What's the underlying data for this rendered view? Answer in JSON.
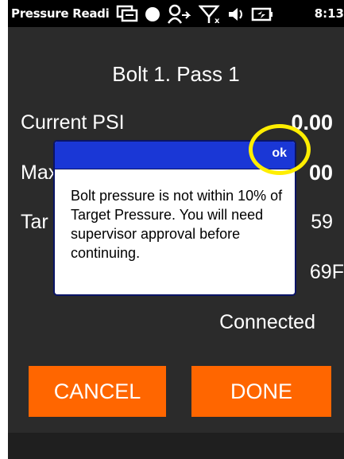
{
  "status_bar": {
    "app_title": "Pressure Readi",
    "icons": [
      "sync-icon",
      "record-icon",
      "person-sync-icon",
      "no-signal-icon",
      "volume-icon",
      "battery-icon"
    ],
    "time": "8:13"
  },
  "screen": {
    "title": "Bolt 1. Pass 1",
    "rows": [
      {
        "label": "Current PSI",
        "value": "0.00"
      },
      {
        "label": "Max",
        "value": "00"
      },
      {
        "label": "Tar",
        "value": "59"
      }
    ],
    "temperature": "69F",
    "connection": "Connected"
  },
  "dialog": {
    "ok_label": "ok",
    "message": "Bolt pressure is not within 10% of Target Pressure. You will need supervisor approval before continuing."
  },
  "buttons": {
    "cancel": "CANCEL",
    "done": "DONE"
  },
  "colors": {
    "background": "#2b2b2b",
    "button": "#ff6600",
    "dialog_header": "#1a37d6",
    "highlight": "#ffee00"
  }
}
